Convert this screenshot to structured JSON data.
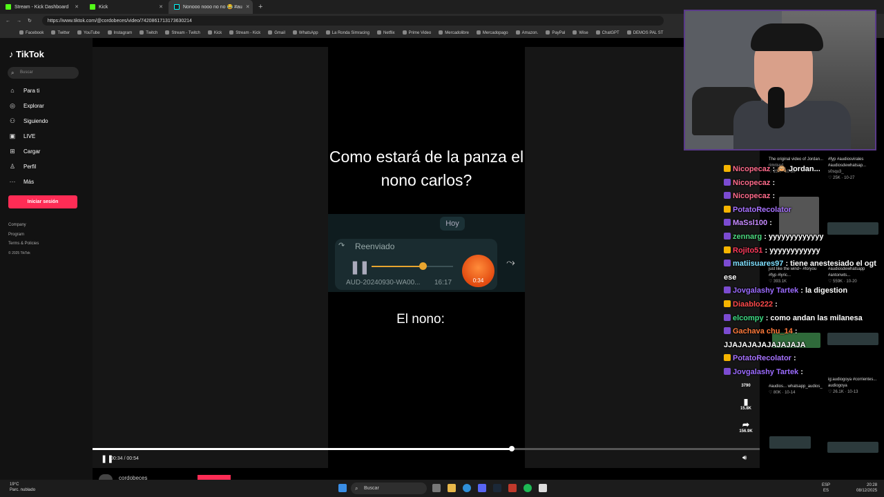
{
  "browser": {
    "tabs": [
      {
        "label": "Stream - Kick Dashboard"
      },
      {
        "label": "Kick"
      },
      {
        "label": "Nonooo nooo no no 😂 #au"
      }
    ],
    "new_tab": "+",
    "url": "https://www.tiktok.com/@cordobeces/video/7420861713173630214",
    "bookmarks": [
      "Facebook",
      "Twitter",
      "YouTube",
      "Instagram",
      "Twitch",
      "Stream - Twitch",
      "Kick",
      "Stream - Kick",
      "Gmail",
      "WhatsApp",
      "La Ronda Simracing",
      "Netflix",
      "Prime Video",
      "Mercadolibre",
      "Mercadopago",
      "Amazon.",
      "PayPal",
      "Wise",
      "ChatGPT",
      "DEMOS PAL ST"
    ]
  },
  "tiktok": {
    "logo": "TikTok",
    "search_placeholder": "Buscar",
    "nav": [
      {
        "label": "Para ti",
        "icon": "home-icon"
      },
      {
        "label": "Explorar",
        "icon": "compass-icon"
      },
      {
        "label": "Siguiendo",
        "icon": "following-icon"
      },
      {
        "label": "LIVE",
        "icon": "live-icon"
      },
      {
        "label": "Cargar",
        "icon": "upload-icon"
      },
      {
        "label": "Perfil",
        "icon": "profile-icon"
      },
      {
        "label": "Más",
        "icon": "more-icon"
      }
    ],
    "login_button": "Iniciar sesión",
    "footer": [
      "Company",
      "Program",
      "Terms & Policies",
      "© 2025 TikTok"
    ]
  },
  "video": {
    "caption": "Como estará de la panza el nono carlos?",
    "voice_note": {
      "day": "Hoy",
      "forwarded": "Reenviado",
      "filename": "AUD-20240930-WA00...",
      "time": "16:17",
      "elapsed": "0:34",
      "progress_fraction": 0.63
    },
    "subtitle": "El nono:",
    "time_display": "00:34 / 00:54",
    "progress_fraction": 0.625,
    "author": "cordobeces",
    "actions": [
      {
        "icon": "comment-icon",
        "count": "3790"
      },
      {
        "icon": "bookmark-icon",
        "count": "15.8K"
      },
      {
        "icon": "share-icon",
        "count": "156.9K"
      }
    ]
  },
  "related": [
    {
      "title": "The original video of Jordan...",
      "user": "rimrised",
      "views": "25K",
      "date": "10-30"
    },
    {
      "title": "#fyp #audiosvirales #audiosdewhatsap...",
      "user": "s0squ3_",
      "views": "25K",
      "date": "10-27"
    },
    {
      "title": "just like the wind~ #foryou #fyp #lyric...",
      "user": "",
      "views": "393.1K",
      "date": ""
    },
    {
      "title": "#audiosdewhatsapp #antonwts...",
      "user": "",
      "views": "559K",
      "date": "10-20"
    },
    {
      "title": "#audios... whatsapp_audios_",
      "user": "",
      "views": "80K",
      "date": "10-14"
    },
    {
      "title": "ig:audiogoya #corrientes... audiogoya",
      "user": "",
      "views": "26.1K",
      "date": "10-13"
    }
  ],
  "chat": [
    {
      "user": "Nicopecaz",
      "color": "#ff6b8b",
      "msg": ": 🙉 Jordan..."
    },
    {
      "user": "Nicopecaz",
      "color": "#ff6b8b",
      "msg": ":"
    },
    {
      "user": "Nicopecaz",
      "color": "#ff6b8b",
      "msg": ":"
    },
    {
      "user": "PotatoRecolator",
      "color": "#a772ff",
      "msg": ""
    },
    {
      "user": "MaSsl100",
      "color": "#c78bff",
      "msg": ":"
    },
    {
      "user": "zennarg",
      "color": "#4cd97f",
      "msg": ": yyyyyyyyyyyyy"
    },
    {
      "user": "Rojito51",
      "color": "#ff3b5c",
      "msg": ": yyyyyyyyyyyy"
    },
    {
      "user": "matiisuares97",
      "color": "#7fe0ff",
      "msg": ": tiene anestesiado el ogt ese"
    },
    {
      "user": "Jovgalashy Tartek",
      "color": "#9b6bff",
      "msg": ": la digestion"
    },
    {
      "user": "Diaablo222",
      "color": "#ff4a4a",
      "msg": ":"
    },
    {
      "user": "elcompy",
      "color": "#3ddc84",
      "msg": ": como andan las milanesa"
    },
    {
      "user": "Gachava chu_14",
      "color": "#ff7a3b",
      "msg": ": JJAJAJAJAJAJAJAJA"
    },
    {
      "user": "PotatoRecolator",
      "color": "#a772ff",
      "msg": ":"
    },
    {
      "user": "Jovgalashy Tartek",
      "color": "#9b6bff",
      "msg": ":"
    }
  ],
  "taskbar": {
    "weather_temp": "19°C",
    "weather_desc": "Parc. nublado",
    "search": "Buscar",
    "lang": "ESP",
    "region": "ES",
    "time": "20:28",
    "date": "08/12/2025"
  },
  "colors": {
    "tiktok_red": "#fe2c55",
    "kick_green": "#53fc18",
    "voice_accent": "#e9a52e"
  }
}
